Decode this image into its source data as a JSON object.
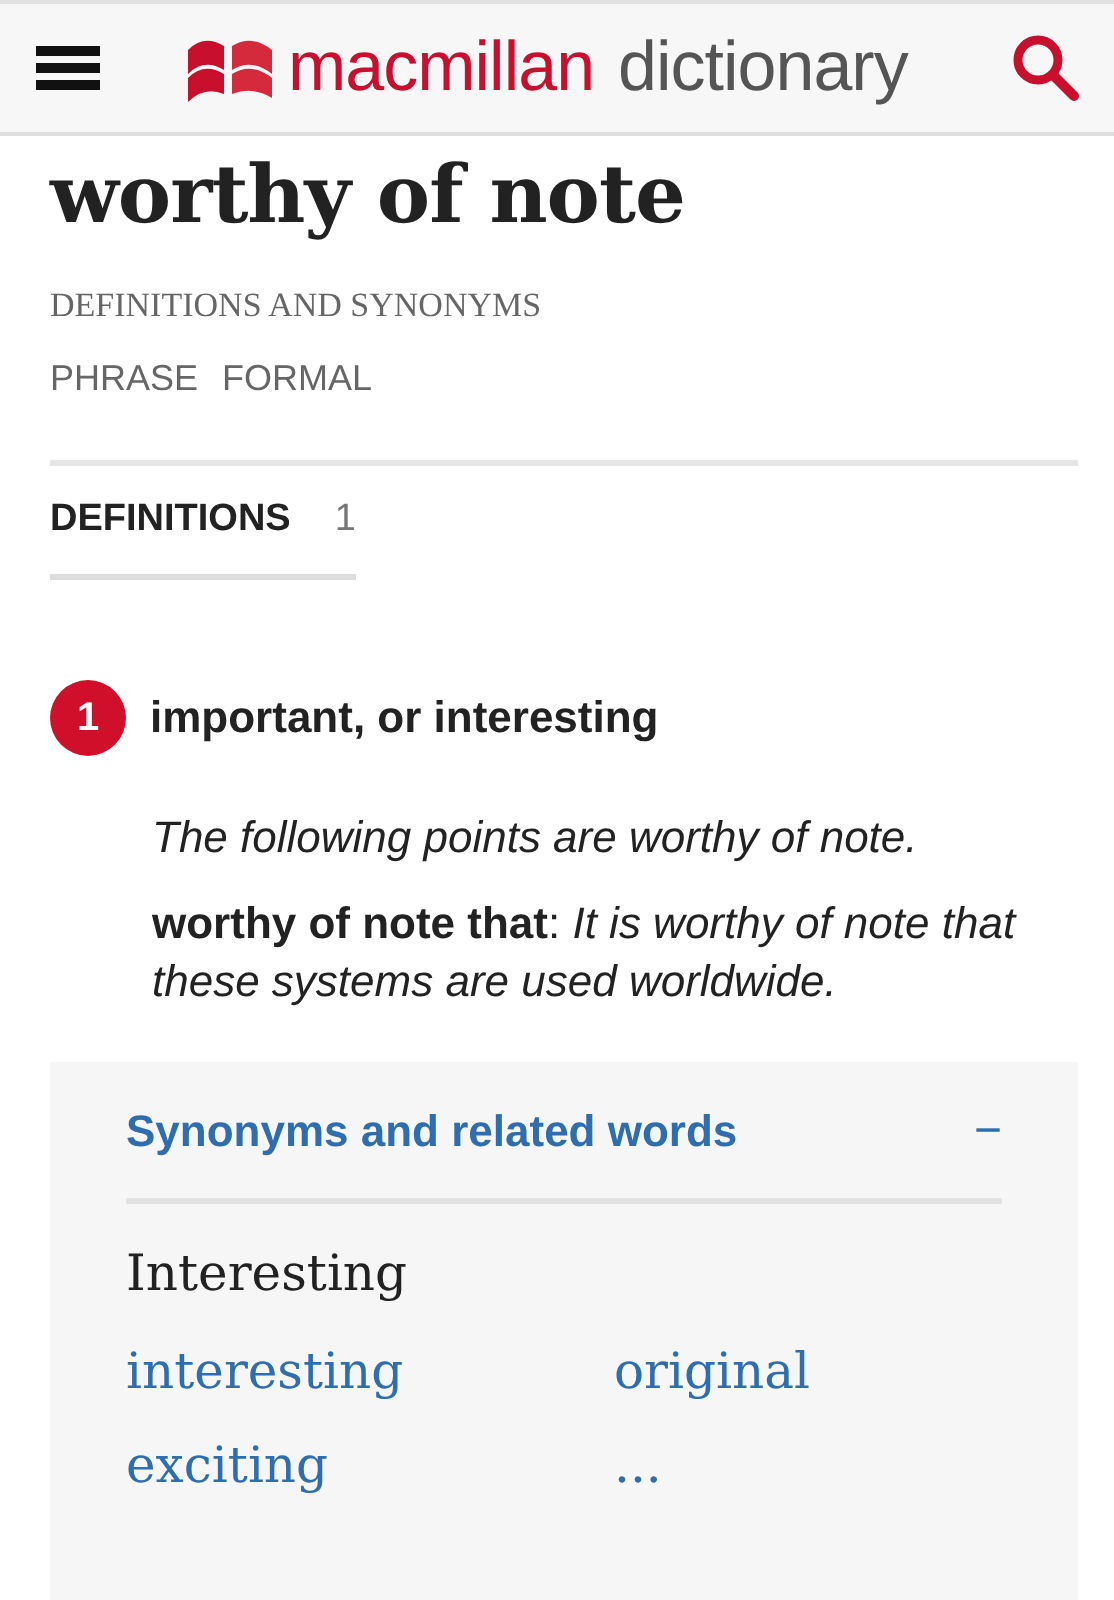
{
  "header": {
    "brand_primary": "macmillan",
    "brand_secondary": "dictionary"
  },
  "entry": {
    "headword": "worthy of note",
    "subtitle": "DEFINITIONS AND SYNONYMS",
    "labels": [
      "PHRASE",
      "FORMAL"
    ]
  },
  "tabs": [
    {
      "label": "DEFINITIONS",
      "count": "1",
      "selected": true
    }
  ],
  "senses": [
    {
      "number": "1",
      "definition": "important, or interesting",
      "examples": [
        {
          "text": "*The following points are worthy of note.*"
        },
        {
          "text": "**worthy of note that**: *It is worthy of note that these systems are used worldwide.*"
        }
      ]
    }
  ],
  "synonyms": {
    "title": "Synonyms and related words",
    "toggle": "−",
    "group": "Interesting",
    "words": [
      "interesting",
      "original",
      "exciting",
      "..."
    ]
  }
}
